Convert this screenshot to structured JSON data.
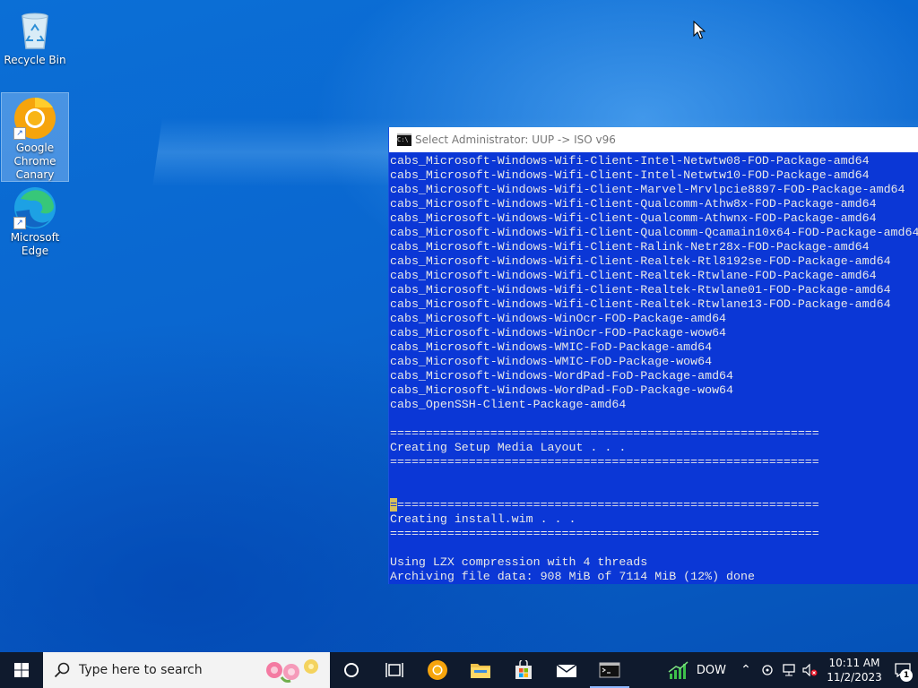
{
  "desktop": {
    "icons": [
      {
        "label": "Recycle Bin",
        "icon": "recycle-bin-icon"
      },
      {
        "label": "Google Chrome Canary",
        "icon": "chrome-canary-icon"
      },
      {
        "label": "Microsoft Edge",
        "icon": "edge-icon"
      }
    ]
  },
  "console": {
    "title": "Select Administrator:  UUP -> ISO v96",
    "lines": [
      "cabs_Microsoft-Windows-Wifi-Client-Intel-Netwtw08-FOD-Package-amd64",
      "cabs_Microsoft-Windows-Wifi-Client-Intel-Netwtw10-FOD-Package-amd64",
      "cabs_Microsoft-Windows-Wifi-Client-Marvel-Mrvlpcie8897-FOD-Package-amd64",
      "cabs_Microsoft-Windows-Wifi-Client-Qualcomm-Athw8x-FOD-Package-amd64",
      "cabs_Microsoft-Windows-Wifi-Client-Qualcomm-Athwnx-FOD-Package-amd64",
      "cabs_Microsoft-Windows-Wifi-Client-Qualcomm-Qcamain10x64-FOD-Package-amd64",
      "cabs_Microsoft-Windows-Wifi-Client-Ralink-Netr28x-FOD-Package-amd64",
      "cabs_Microsoft-Windows-Wifi-Client-Realtek-Rtl8192se-FOD-Package-amd64",
      "cabs_Microsoft-Windows-Wifi-Client-Realtek-Rtwlane-FOD-Package-amd64",
      "cabs_Microsoft-Windows-Wifi-Client-Realtek-Rtwlane01-FOD-Package-amd64",
      "cabs_Microsoft-Windows-Wifi-Client-Realtek-Rtwlane13-FOD-Package-amd64",
      "cabs_Microsoft-Windows-WinOcr-FOD-Package-amd64",
      "cabs_Microsoft-Windows-WinOcr-FOD-Package-wow64",
      "cabs_Microsoft-Windows-WMIC-FoD-Package-amd64",
      "cabs_Microsoft-Windows-WMIC-FoD-Package-wow64",
      "cabs_Microsoft-Windows-WordPad-FoD-Package-amd64",
      "cabs_Microsoft-Windows-WordPad-FoD-Package-wow64",
      "cabs_OpenSSH-Client-Package-amd64",
      "",
      "============================================================",
      "Creating Setup Media Layout . . .",
      "============================================================",
      "",
      "",
      "=",
      "Creating install.wim . . .",
      "============================================================",
      "",
      "Using LZX compression with 4 threads",
      "Archiving file data: 908 MiB of 7114 MiB (12%) done"
    ],
    "cursor_line_rest": "===========================================================",
    "colors": {
      "background": "#0b37d6",
      "text": "#e8e8e8",
      "selection": "#d8c05a"
    }
  },
  "taskbar": {
    "search_placeholder": "Type here to search",
    "apps": [
      "start-icon",
      "cortana-icon",
      "task-view-icon",
      "chrome-canary-icon",
      "file-explorer-icon",
      "store-icon",
      "mail-icon",
      "terminal-icon"
    ],
    "stock_ticker": "DOW",
    "clock_time": "10:11 AM",
    "clock_date": "11/2/2023",
    "notification_count": "1"
  }
}
